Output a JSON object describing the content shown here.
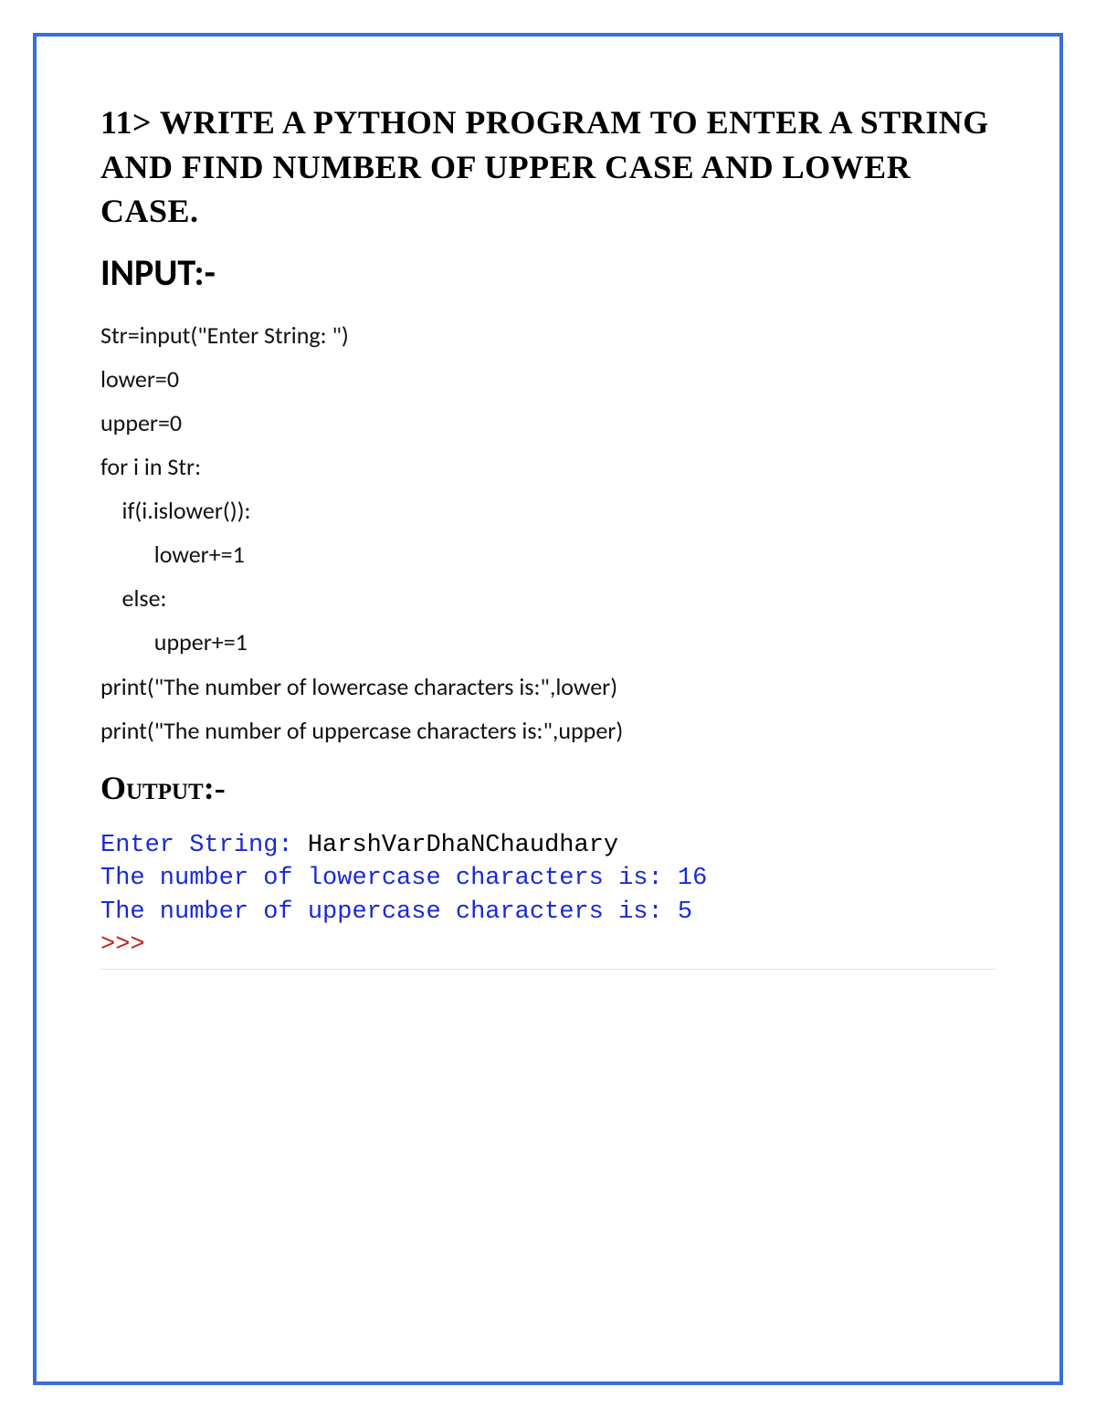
{
  "title": "11> Write A Python program to enter a string and find number of upper case and lower case.",
  "sections": {
    "input_label": "INPUT:-",
    "output_label": "Output:-"
  },
  "code": {
    "l1": "Str=input(\"Enter String: \")",
    "l2": "lower=0",
    "l3": "upper=0",
    "l4": "for i in Str:",
    "l5": "    if(i.islower()):",
    "l6": "          lower+=1",
    "l7": "    else:",
    "l8": "          upper+=1",
    "l9": "print(\"The number of lowercase characters is:\",lower)",
    "l10": "print(\"The number of uppercase characters is:\",upper)"
  },
  "console": {
    "prompt1_label": "Enter String: ",
    "prompt1_value": "HarshVarDhaNChaudhary",
    "line2_a": "The number of lowercase characters is: ",
    "line2_b": "16",
    "line3_a": "The number of uppercase characters is: ",
    "line3_b": "5",
    "prompt2": ">>>"
  }
}
